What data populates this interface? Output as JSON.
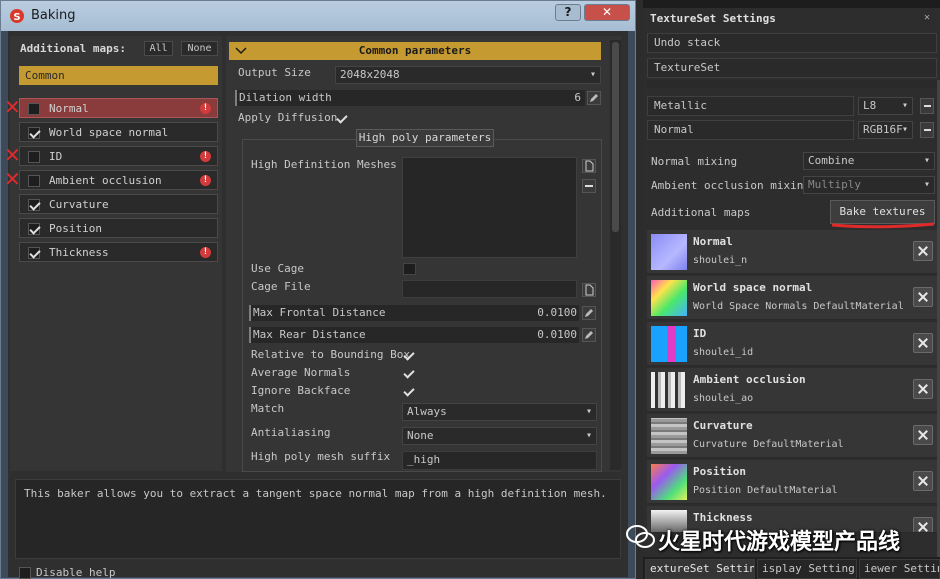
{
  "baking": {
    "title": "Baking",
    "help_button": "?",
    "additional_maps_label": "Additional maps:",
    "all_button": "All",
    "none_button": "None",
    "common_label": "Common",
    "maps": [
      {
        "label": "Normal",
        "checked": false,
        "error": true
      },
      {
        "label": "World space normal",
        "checked": true,
        "error": false
      },
      {
        "label": "ID",
        "checked": false,
        "error": true
      },
      {
        "label": "Ambient occlusion",
        "checked": false,
        "error": true
      },
      {
        "label": "Curvature",
        "checked": true,
        "error": false
      },
      {
        "label": "Position",
        "checked": true,
        "error": false
      },
      {
        "label": "Thickness",
        "checked": true,
        "error": true
      }
    ],
    "common_params": {
      "header": "Common parameters",
      "output_size_label": "Output Size",
      "output_size_value": "2048x2048",
      "dilation_width_label": "Dilation width",
      "dilation_width_value": "6",
      "apply_diffusion_label": "Apply Diffusion",
      "apply_diffusion": true
    },
    "high_poly": {
      "header": "High poly parameters",
      "hd_meshes_label": "High Definition Meshes",
      "use_cage_label": "Use Cage",
      "use_cage": false,
      "cage_file_label": "Cage File",
      "cage_file_value": "",
      "max_frontal_label": "Max Frontal Distance",
      "max_frontal_value": "0.0100",
      "max_rear_label": "Max Rear Distance",
      "max_rear_value": "0.0100",
      "relative_bbox_label": "Relative to Bounding Box",
      "relative_bbox": true,
      "average_normals_label": "Average Normals",
      "average_normals": true,
      "ignore_backface_label": "Ignore Backface",
      "ignore_backface": true,
      "match_label": "Match",
      "match_value": "Always",
      "antialiasing_label": "Antialiasing",
      "antialiasing_value": "None",
      "suffix_label": "High poly mesh suffix",
      "suffix_value": "_high"
    },
    "help_text": "This baker allows you to extract a tangent space normal map from a high definition mesh.",
    "disable_help_label": "Disable help"
  },
  "textureset": {
    "title": "TextureSet Settings",
    "undo_stack_label": "Undo stack",
    "textureset_label": "TextureSet",
    "channels": [
      {
        "name": "Metallic",
        "format": "L8"
      },
      {
        "name": "Normal",
        "format": "RGB16F"
      }
    ],
    "normal_mixing_label": "Normal mixing",
    "normal_mixing_value": "Combine",
    "ao_mixing_label": "Ambient occlusion mixing",
    "ao_mixing_value": "Multiply",
    "additional_maps_label": "Additional maps",
    "bake_textures_button": "Bake textures",
    "maps": [
      {
        "name": "Normal",
        "source": "shoulei_n",
        "icon": "normal-map-thumbnail"
      },
      {
        "name": "World space normal",
        "source": "World Space Normals DefaultMaterial",
        "icon": "world-normal-thumbnail"
      },
      {
        "name": "ID",
        "source": "shoulei_id",
        "icon": "id-map-thumbnail"
      },
      {
        "name": "Ambient occlusion",
        "source": "shoulei_ao",
        "icon": "ao-map-thumbnail"
      },
      {
        "name": "Curvature",
        "source": "Curvature DefaultMaterial",
        "icon": "curvature-thumbnail"
      },
      {
        "name": "Position",
        "source": "Position DefaultMaterial",
        "icon": "position-thumbnail"
      },
      {
        "name": "Thickness",
        "source": "",
        "icon": "thickness-thumbnail"
      }
    ],
    "bottom_tabs": [
      "extureSet Setting",
      "isplay Setting",
      "iewer Setting"
    ]
  },
  "watermark_text": "火星时代游戏模型产品线",
  "colors": {
    "accent_gold": "#c59a30",
    "error_red": "#d23b3b",
    "annotation_red": "#e02a2a"
  }
}
